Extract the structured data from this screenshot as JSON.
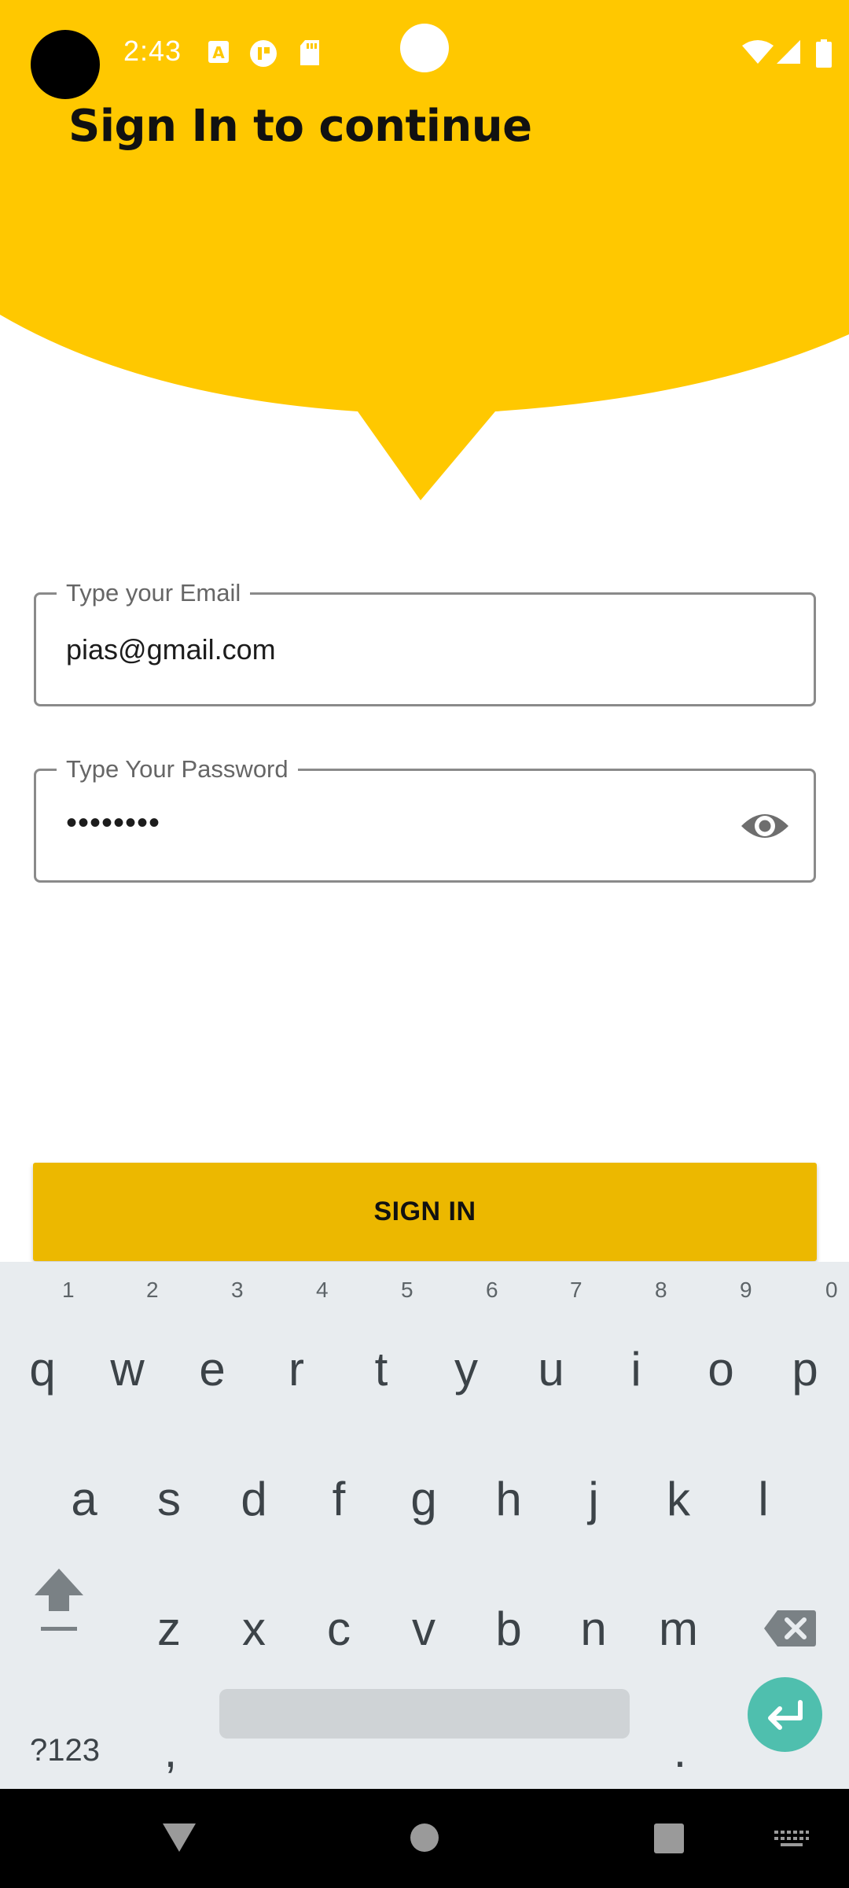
{
  "colors": {
    "brand_yellow": "#ffc800",
    "button_yellow": "#ecb800",
    "keyboard_bg": "#e8ecef",
    "enter_key": "#4fbfae"
  },
  "status_bar": {
    "time": "2:43",
    "icons": [
      "camera-cutout-icon",
      "a-notification-icon",
      "app-notification-icon",
      "sd-card-icon",
      "wifi-icon",
      "signal-icon",
      "battery-icon"
    ]
  },
  "header": {
    "title": "Sign In to continue"
  },
  "form": {
    "email": {
      "label": "Type your Email",
      "value": "pias@gmail.com"
    },
    "password": {
      "label": "Type Your Password",
      "value": "••••••••"
    },
    "signin_button": "SIGN IN"
  },
  "keyboard": {
    "row1": [
      {
        "key": "q",
        "hint": "1"
      },
      {
        "key": "w",
        "hint": "2"
      },
      {
        "key": "e",
        "hint": "3"
      },
      {
        "key": "r",
        "hint": "4"
      },
      {
        "key": "t",
        "hint": "5"
      },
      {
        "key": "y",
        "hint": "6"
      },
      {
        "key": "u",
        "hint": "7"
      },
      {
        "key": "i",
        "hint": "8"
      },
      {
        "key": "o",
        "hint": "9"
      },
      {
        "key": "p",
        "hint": "0"
      }
    ],
    "row2": [
      "a",
      "s",
      "d",
      "f",
      "g",
      "h",
      "j",
      "k",
      "l"
    ],
    "row3": [
      "z",
      "x",
      "c",
      "v",
      "b",
      "n",
      "m"
    ],
    "symbols_key": "?123",
    "comma_key": ",",
    "period_key": ".",
    "special_icons": [
      "shift-icon",
      "backspace-icon",
      "enter-icon"
    ]
  },
  "nav_bar": {
    "icons": [
      "back-icon",
      "home-icon",
      "recents-icon",
      "keyboard-switch-icon"
    ]
  }
}
